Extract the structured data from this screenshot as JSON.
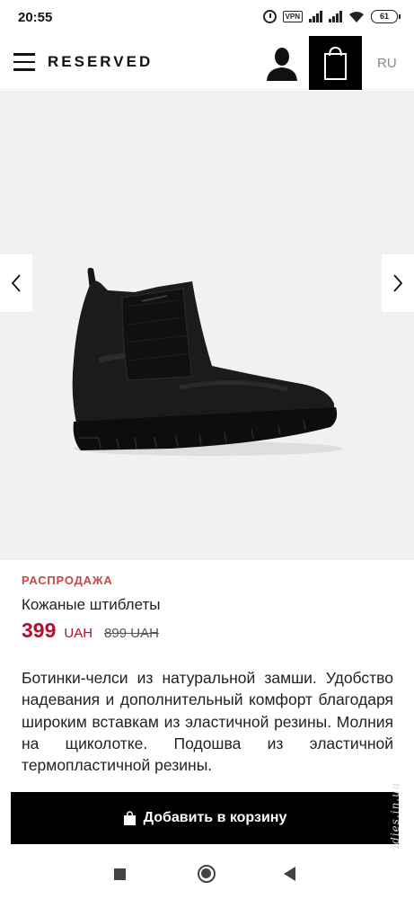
{
  "status_bar": {
    "time": "20:55",
    "vpn_label": "VPN",
    "battery": "61",
    "icons": [
      "alarm-icon",
      "vpn-icon",
      "signal-icon",
      "signal-icon",
      "wifi-icon",
      "battery-icon"
    ]
  },
  "header": {
    "logo": "RESERVED",
    "language": "RU",
    "icons": [
      "menu-icon",
      "user-icon",
      "shopping-bag-icon"
    ]
  },
  "gallery": {
    "image": "black-suede-chelsea-boot",
    "prev_icon": "chevron-left-icon",
    "next_icon": "chevron-right-icon",
    "background_color": "#f1f1f1"
  },
  "product": {
    "sale_label": "РАСПРОДАЖА",
    "title": "Кожаные штиблеты",
    "price": "399",
    "currency": "UAH",
    "old_price": "899 UAH",
    "description": "Ботинки-челси из натуральной замши. Удобство надевания и дополнительный комфорт благодаря широким вставкам из эластичной резины. Молния на щиколотке. Подошва из эластичной термопластичной резины."
  },
  "actions": {
    "add_to_cart": "Добавить в корзину",
    "add_to_cart_icon": "shopping-bag-icon"
  },
  "watermark": "Ladies.in.ua",
  "colors": {
    "sale_accent": "#d0453f",
    "price_accent": "#b2102f",
    "primary_button": "#000000"
  },
  "nav_bar": {
    "icons": [
      "recent-apps-icon",
      "home-icon",
      "back-icon"
    ]
  }
}
